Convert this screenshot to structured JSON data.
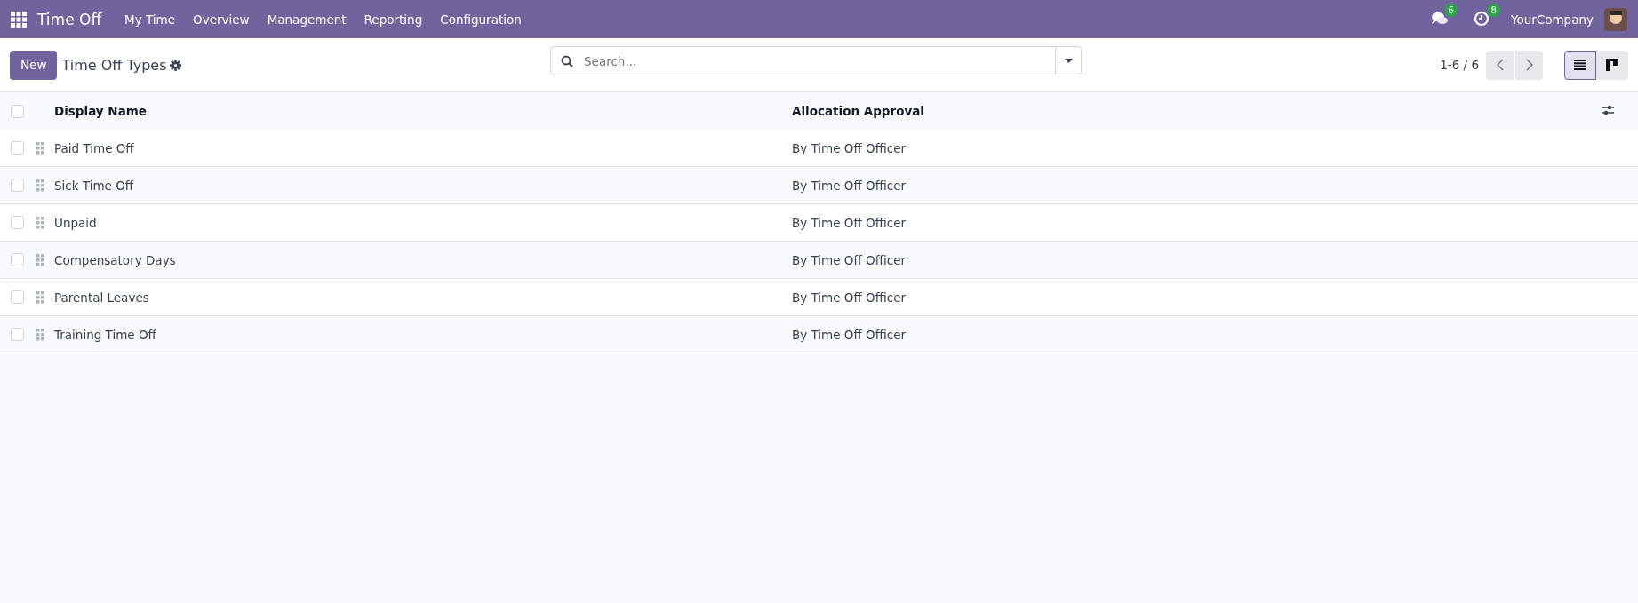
{
  "navbar": {
    "app_name": "Time Off",
    "menu": [
      "My Time",
      "Overview",
      "Management",
      "Reporting",
      "Configuration"
    ],
    "messages_count": "6",
    "activities_count": "8",
    "company": "YourCompany"
  },
  "control_panel": {
    "new_button": "New",
    "title": "Time Off Types",
    "search": {
      "placeholder": "Search..."
    },
    "pager": "1-6 / 6",
    "views": [
      {
        "kind": "list",
        "selected": true
      },
      {
        "kind": "kanban",
        "selected": false
      }
    ]
  },
  "table": {
    "select_all_checked": false,
    "columns": [
      "Display Name",
      "Allocation Approval"
    ],
    "rows": [
      {
        "name": "Paid Time Off",
        "approval": "By Time Off Officer",
        "checked": false
      },
      {
        "name": "Sick Time Off",
        "approval": "By Time Off Officer",
        "checked": false
      },
      {
        "name": "Unpaid",
        "approval": "By Time Off Officer",
        "checked": false
      },
      {
        "name": "Compensatory Days",
        "approval": "By Time Off Officer",
        "checked": false
      },
      {
        "name": "Parental Leaves",
        "approval": "By Time Off Officer",
        "checked": false
      },
      {
        "name": "Training Time Off",
        "approval": "By Time Off Officer",
        "checked": false
      }
    ]
  }
}
